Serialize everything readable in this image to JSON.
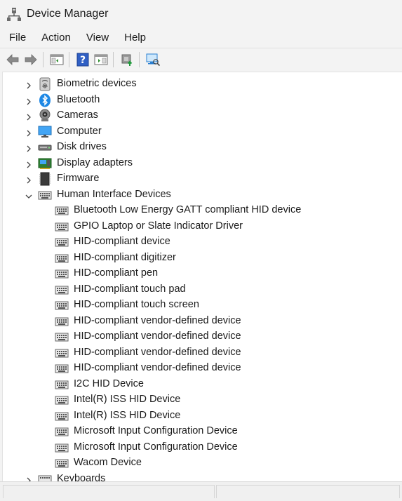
{
  "window": {
    "title": "Device Manager"
  },
  "menu": [
    "File",
    "Action",
    "View",
    "Help"
  ],
  "toolbar": {
    "buttons": [
      {
        "icon": "back-arrow-icon"
      },
      {
        "icon": "forward-arrow-icon"
      },
      {
        "icon": "show-hide-console-tree-icon"
      },
      {
        "icon": "help-icon"
      },
      {
        "icon": "action-pane-icon"
      },
      {
        "icon": "update-driver-icon"
      },
      {
        "icon": "scan-hardware-changes-icon"
      }
    ]
  },
  "tree": {
    "categories": [
      {
        "label": "Biometric devices",
        "icon": "fingerprint-icon",
        "expanded": false
      },
      {
        "label": "Bluetooth",
        "icon": "bluetooth-icon",
        "expanded": false
      },
      {
        "label": "Cameras",
        "icon": "camera-icon",
        "expanded": false
      },
      {
        "label": "Computer",
        "icon": "monitor-icon",
        "expanded": false
      },
      {
        "label": "Disk drives",
        "icon": "disk-drive-icon",
        "expanded": false
      },
      {
        "label": "Display adapters",
        "icon": "display-adapter-icon",
        "expanded": false
      },
      {
        "label": "Firmware",
        "icon": "firmware-chip-icon",
        "expanded": false
      },
      {
        "label": "Human Interface Devices",
        "icon": "hid-keyboard-icon",
        "expanded": true,
        "children": [
          "Bluetooth Low Energy GATT compliant HID device",
          "GPIO Laptop or Slate Indicator Driver",
          "HID-compliant device",
          "HID-compliant digitizer",
          "HID-compliant pen",
          "HID-compliant touch pad",
          "HID-compliant touch screen",
          "HID-compliant vendor-defined device",
          "HID-compliant vendor-defined device",
          "HID-compliant vendor-defined device",
          "HID-compliant vendor-defined device",
          "I2C HID Device",
          "Intel(R) ISS HID Device",
          "Intel(R) ISS HID Device",
          "Microsoft Input Configuration Device",
          "Microsoft Input Configuration Device",
          "Wacom Device"
        ]
      },
      {
        "label": "Keyboards",
        "icon": "keyboard-icon",
        "expanded": false
      }
    ]
  },
  "colors": {
    "accent_blue": "#1e88e5",
    "tree_bg": "#ffffff",
    "chrome_bg": "#f3f3f3"
  }
}
